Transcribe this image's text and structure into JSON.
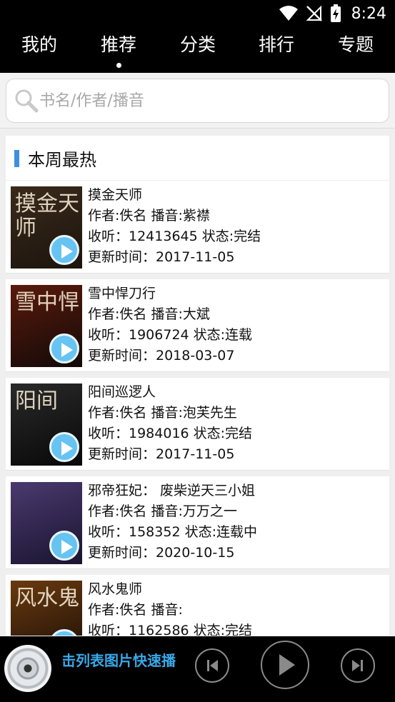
{
  "status_bar": {
    "time": "8:24",
    "icons": [
      "wifi-icon",
      "no-signal-icon",
      "battery-charging-icon"
    ]
  },
  "nav": {
    "tabs": [
      {
        "label": "我的"
      },
      {
        "label": "推荐",
        "active": true
      },
      {
        "label": "分类"
      },
      {
        "label": "排行"
      },
      {
        "label": "专题"
      }
    ]
  },
  "search": {
    "placeholder": "书名/作者/播音",
    "value": ""
  },
  "section": {
    "title": "本周最热"
  },
  "books": [
    {
      "title": "摸金天师",
      "cover_text": "摸金天师",
      "author_line": "作者:佚名 播音:紫襟",
      "listen_line": "收听：12413645 状态:完结",
      "update_line": "更新时间：2017-11-05",
      "cover_colors": [
        "#3a2a1c",
        "#1c140d"
      ]
    },
    {
      "title": "雪中悍刀行",
      "cover_text": "雪中悍",
      "author_line": "作者:佚名 播音:大斌",
      "listen_line": "收听：1906724 状态:连载",
      "update_line": "更新时间：2018-03-07",
      "cover_colors": [
        "#5a1a0c",
        "#120a08"
      ]
    },
    {
      "title": "阳间巡逻人",
      "cover_text": "阳间",
      "author_line": "作者:佚名 播音:泡芙先生",
      "listen_line": "收听：1984016 状态:完结",
      "update_line": "更新时间：2017-11-05",
      "cover_colors": [
        "#2a2a2a",
        "#080808"
      ]
    },
    {
      "title": "邪帝狂妃： 废柴逆天三小姐",
      "cover_text": "",
      "author_line": "作者:佚名 播音:万万之一",
      "listen_line": "收听：158352 状态:连载中",
      "update_line": "更新时间：2020-10-15",
      "cover_colors": [
        "#4a3a6e",
        "#1a1430"
      ]
    },
    {
      "title": "风水鬼师",
      "cover_text": "风水鬼",
      "author_line": "作者:佚名 播音:",
      "listen_line": "收听：1162586 状态:完结",
      "update_line": "",
      "cover_colors": [
        "#6a3a10",
        "#1a0e06"
      ]
    }
  ],
  "player": {
    "marquee_text": "点击列表图片快速播放"
  },
  "colors": {
    "accent": "#3d8fe0",
    "marquee": "#39a8e8",
    "play_badge": "#67c3f2"
  }
}
